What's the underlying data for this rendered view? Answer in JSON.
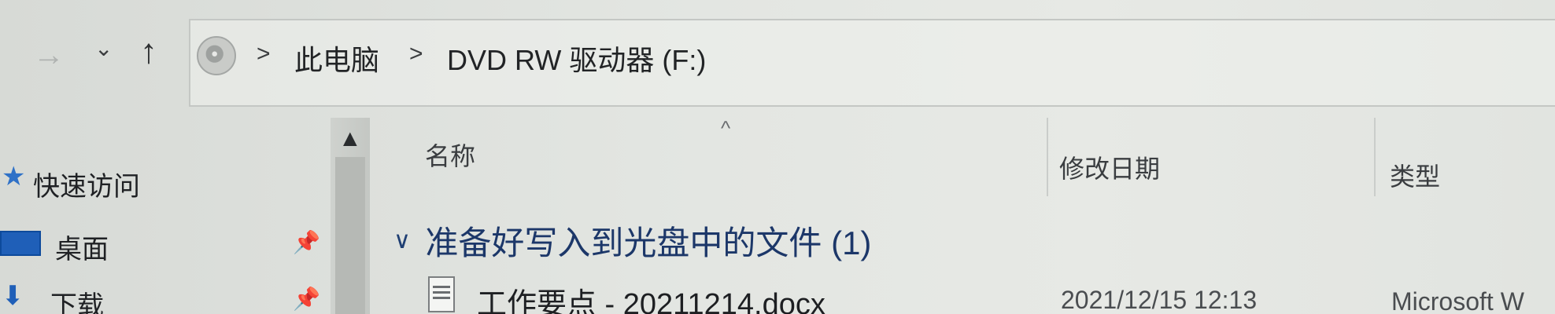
{
  "toolbar": {
    "back_icon": "arrow-right-icon",
    "recent_icon": "chevron-down-icon",
    "up_icon": "arrow-up-icon"
  },
  "address": {
    "drive_icon": "disc-drive-icon",
    "separator": ">",
    "crumbs": [
      "此电脑",
      "DVD RW 驱动器 (F:)"
    ]
  },
  "sidebar": {
    "items": [
      {
        "label": "快速访问",
        "icon": "star-icon"
      },
      {
        "label": "桌面",
        "icon": "desktop-icon",
        "pinned": true
      },
      {
        "label": "下载",
        "icon": "download-icon",
        "pinned": true
      }
    ],
    "pin_glyph": "📌",
    "scroll_up_glyph": "▲"
  },
  "columns": {
    "name": "名称",
    "date": "修改日期",
    "type": "类型",
    "sort_glyph": "^"
  },
  "group": {
    "chevron": "∨",
    "title": "准备好写入到光盘中的文件 (1)"
  },
  "files": [
    {
      "name": "工作要点 - 20211214.docx",
      "date": "2021/12/15 12:13",
      "type": "Microsoft W"
    }
  ],
  "colors": {
    "background": "#e3e6e2",
    "group_title": "#1c3769",
    "accent": "#1f5fb8"
  }
}
